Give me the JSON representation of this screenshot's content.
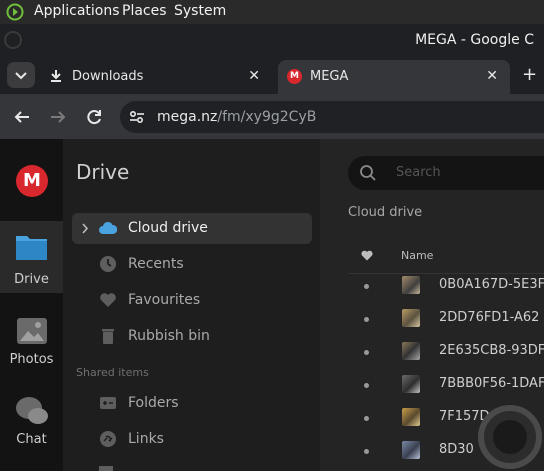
{
  "system_bar": {
    "menus": [
      "Applications",
      "Places",
      "System"
    ]
  },
  "window": {
    "title": "MEGA - Google C"
  },
  "tabs": [
    {
      "label": "Downloads",
      "icon": "download-icon"
    },
    {
      "label": "MEGA",
      "icon": "mega-logo-icon"
    }
  ],
  "address_bar": {
    "host": "mega.nz",
    "path": "/fm/xy9g2CyB"
  },
  "rail": {
    "logo_letter": "M",
    "items": [
      {
        "label": "Drive",
        "icon": "folder-icon"
      },
      {
        "label": "Photos",
        "icon": "image-icon"
      },
      {
        "label": "Chat",
        "icon": "chat-icon"
      }
    ]
  },
  "sidebar": {
    "title": "Drive",
    "nav": [
      {
        "label": "Cloud drive",
        "icon": "cloud-icon"
      },
      {
        "label": "Recents",
        "icon": "clock-icon"
      },
      {
        "label": "Favourites",
        "icon": "heart-icon"
      },
      {
        "label": "Rubbish bin",
        "icon": "trash-icon"
      }
    ],
    "shared_header": "Shared items",
    "shared": [
      {
        "label": "Folders",
        "icon": "shared-folder-icon"
      },
      {
        "label": "Links",
        "icon": "link-icon"
      }
    ]
  },
  "main": {
    "search_placeholder": "Search",
    "breadcrumb": "Cloud drive",
    "column_name": "Name",
    "files": [
      {
        "name": "0B0A167D-5E3F"
      },
      {
        "name": "2DD76FD1-A62"
      },
      {
        "name": "2E635CB8-93DF"
      },
      {
        "name": "7BBB0F56-1DAF"
      },
      {
        "name": "7F157D"
      },
      {
        "name": "8D30"
      }
    ]
  },
  "colors": {
    "mega_red": "#d9272e",
    "accent_blue": "#4aa3df"
  }
}
